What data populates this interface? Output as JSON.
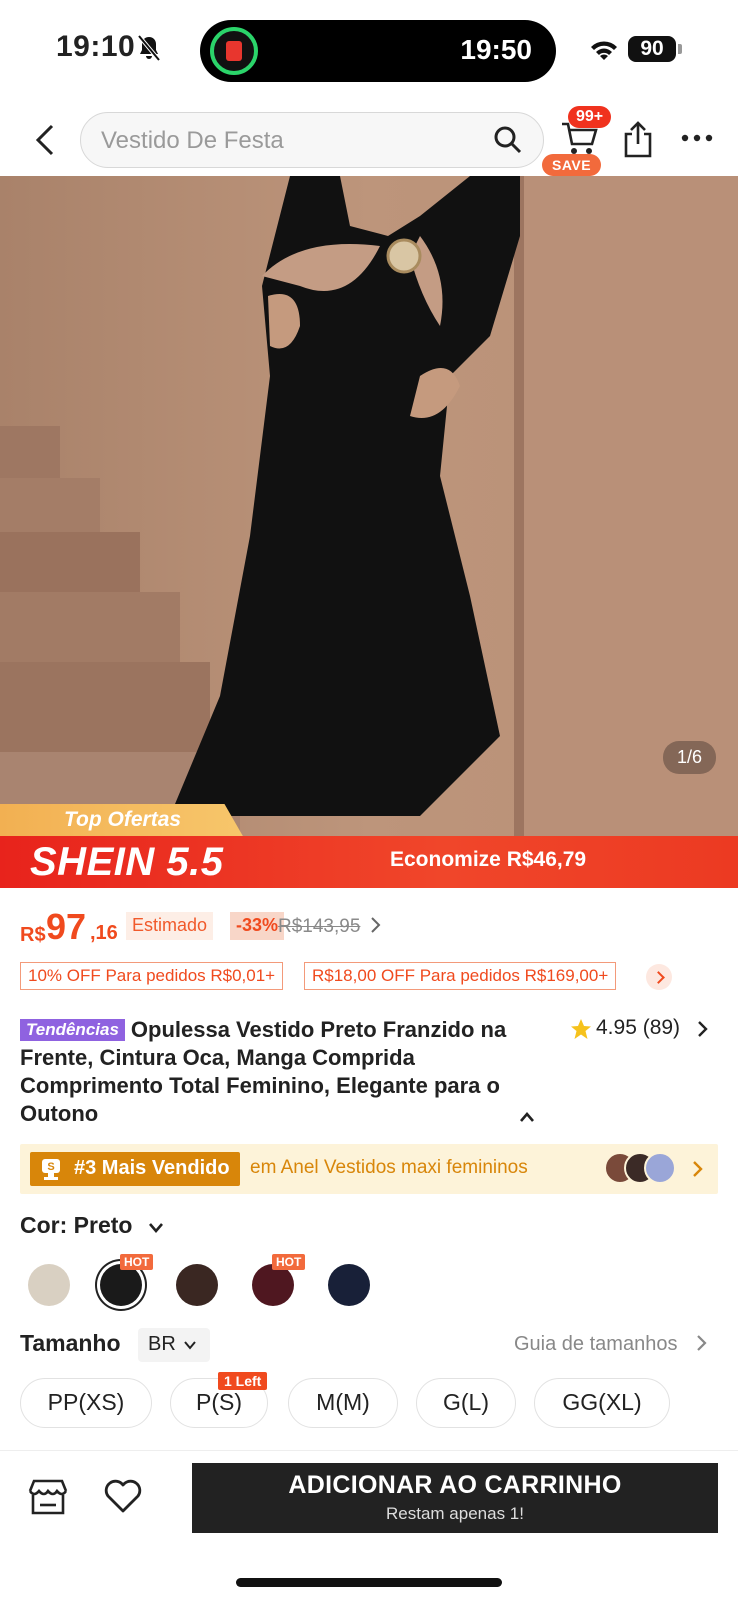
{
  "status_bar": {
    "time": "19:10",
    "island_time": "19:50",
    "battery": "90"
  },
  "search": {
    "placeholder": "Vestido De Festa",
    "cart_count": "99+",
    "save_tag": "SAVE"
  },
  "gallery": {
    "counter": "1/6"
  },
  "promo": {
    "top_offer": "Top Ofertas",
    "campaign": "SHEIN 5.5",
    "savings": "Economize R$46,79"
  },
  "price": {
    "currency": "R$",
    "integer": "97",
    "decimals": ",16",
    "estimado": "Estimado",
    "discount": "-33%",
    "original": "R$143,95"
  },
  "coupons": [
    "10% OFF Para pedidos R$0,01+",
    "R$18,00 OFF Para pedidos R$169,00+"
  ],
  "product": {
    "trend_badge": "Tendências",
    "title": "Opulessa Vestido Preto Franzido na Frente, Cintura Oca, Manga Comprida Comprimento Total Feminino, Elegante para o Outono",
    "rating": "4.95 (89)"
  },
  "best_seller": {
    "badge": "#3 Mais Vendido",
    "text": "em Anel Vestidos maxi femininos"
  },
  "color": {
    "label": "Cor: Preto",
    "hot_label": "HOT",
    "swatches": [
      {
        "name": "bege",
        "color": "#d9d0c2",
        "hot": false
      },
      {
        "name": "preto",
        "color": "#1a1a1a",
        "hot": true,
        "selected": true
      },
      {
        "name": "marrom",
        "color": "#3a2722",
        "hot": false
      },
      {
        "name": "vinho",
        "color": "#4f1720",
        "hot": true
      },
      {
        "name": "azul-marinho",
        "color": "#182038",
        "hot": false
      }
    ]
  },
  "size": {
    "label": "Tamanho",
    "region": "BR",
    "guide": "Guia de tamanhos",
    "left_tag": "1 Left",
    "options": [
      "PP(XS)",
      "P(S)",
      "M(M)",
      "G(L)",
      "GG(XL)"
    ]
  },
  "cta": {
    "label": "ADICIONAR AO CARRINHO",
    "sub": "Restam apenas 1!"
  },
  "colors": {
    "accent": "#f04a1e",
    "banner": "#e8231c",
    "trend": "#8f62e0",
    "best_badge": "#d8860a"
  }
}
